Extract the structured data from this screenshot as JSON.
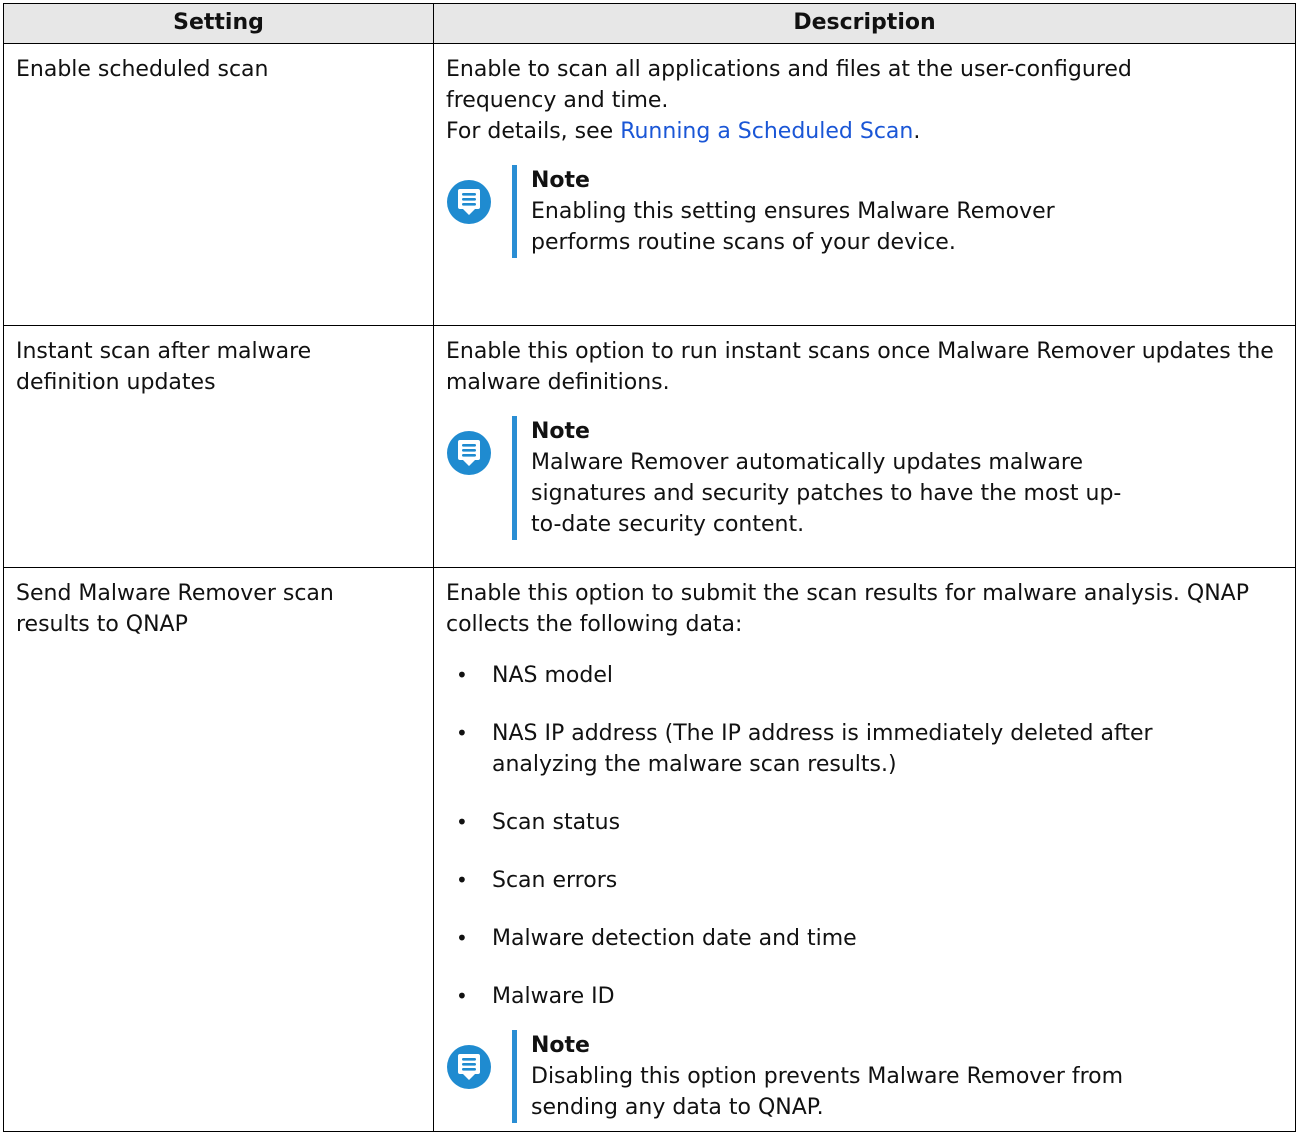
{
  "table": {
    "headers": {
      "setting": "Setting",
      "description": "Description"
    },
    "rows": [
      {
        "setting": "Enable scheduled scan",
        "desc_line1": "Enable to scan all applications and files at the user-configured frequency and time.",
        "desc_details_prefix": "For details, see ",
        "desc_link": "Running a Scheduled Scan",
        "desc_details_suffix": ".",
        "note_title": "Note",
        "note_text": "Enabling this setting ensures Malware Remover performs routine scans of your device."
      },
      {
        "setting": "Instant scan after malware definition updates",
        "desc_line1": "Enable this option to run instant scans once Malware Remover updates the malware definitions.",
        "note_title": "Note",
        "note_text": "Malware Remover automatically updates malware signatures and security patches to have the most up-to-date security content."
      },
      {
        "setting": "Send Malware Remover scan results to QNAP",
        "desc_line1": "Enable this option to submit the scan results for malware analysis. QNAP collects the following data:",
        "items": [
          "NAS model",
          "NAS IP address (The IP address is immediately deleted after analyzing the malware scan results.)",
          "Scan status",
          "Scan errors",
          "Malware detection date and time",
          "Malware ID"
        ],
        "note_title": "Note",
        "note_text": "Disabling this option prevents Malware Remover from sending any data to QNAP."
      }
    ]
  },
  "icons": {
    "note": "note-icon"
  },
  "colors": {
    "link": "#1a56d6",
    "note_accent": "#2a8ed4",
    "header_bg": "#e7e7e7"
  }
}
